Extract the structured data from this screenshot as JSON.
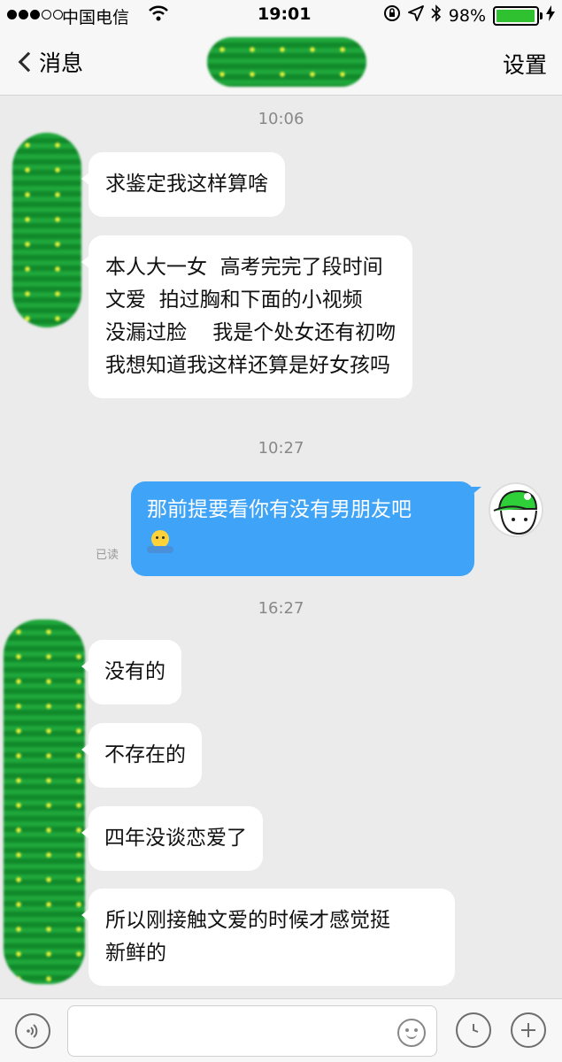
{
  "status_bar": {
    "carrier": "中国电信",
    "time": "19:01",
    "battery": "98%",
    "battery_level": 0.98
  },
  "nav": {
    "back_label": "消息",
    "settings_label": "设置"
  },
  "chat": {
    "groups": [
      {
        "time": "10:06"
      },
      {
        "time": "10:27"
      },
      {
        "time": "16:27"
      }
    ],
    "msg1": "求鉴定我这样算啥",
    "msg2": [
      "本人大一女  高考完完了段时间",
      "文爱  拍过胸和下面的小视频",
      "没漏过脸    我是个处女还有初吻",
      "我想知道我这样还算是好女孩吗"
    ],
    "outgoing": {
      "text": "那前提要看你有没有男朋友吧",
      "read_receipt": "已读"
    },
    "msg3": "没有的",
    "msg4": "不存在的",
    "msg5": "四年没谈恋爱了",
    "msg6": [
      "所以刚接触文爱的时候才感觉挺",
      "新鲜的"
    ]
  },
  "colors": {
    "outgoing_bubble": "#3fa4f7",
    "incoming_bubble": "#ffffff",
    "background": "#ebebeb"
  }
}
